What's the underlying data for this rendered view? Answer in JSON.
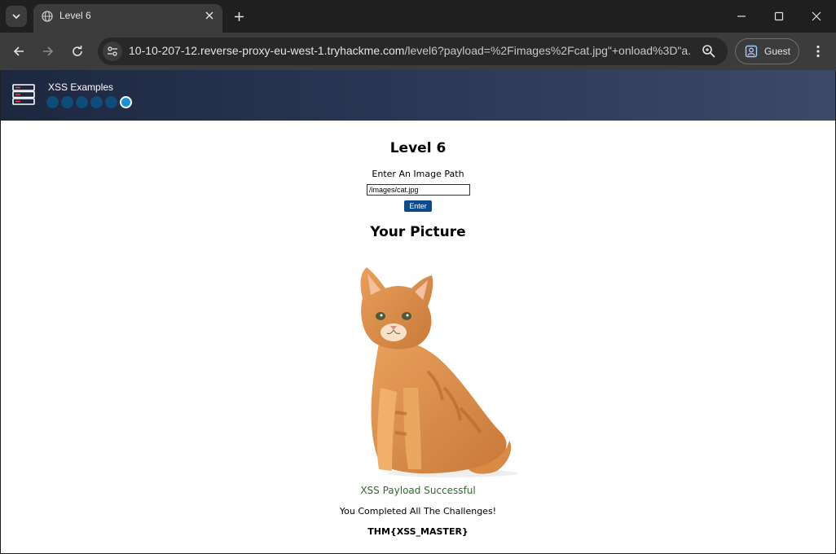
{
  "browser": {
    "tab_title": "Level 6",
    "url_host": "10-10-207-12.reverse-proxy-eu-west-1.tryhackme.com",
    "url_rest": "/level6?payload=%2Fimages%2Fcat.jpg\"+onload%3D\"a...",
    "profile_label": "Guest"
  },
  "header": {
    "title": "XSS Examples",
    "progress_total": 6,
    "progress_current": 6
  },
  "page": {
    "level_title": "Level 6",
    "input_label": "Enter An Image Path",
    "input_value": "/images/cat.jpg",
    "enter_label": "Enter",
    "picture_title": "Your Picture",
    "success_text": "XSS Payload Successful",
    "completed_text": "You Completed All The Challenges!",
    "flag_text": "THM{XSS_MASTER}"
  },
  "colors": {
    "header_bg": "#2c3a58",
    "dot_inactive": "#0e4d7a",
    "dot_active": "#1a8fd8",
    "button_bg": "#0d4a8c",
    "success_text": "#2e6b2e"
  },
  "icons": [
    "tab-search-icon",
    "globe-icon",
    "close-icon",
    "plus-icon",
    "minimize-icon",
    "maximize-icon",
    "window-close-icon",
    "back-arrow-icon",
    "forward-arrow-icon",
    "reload-icon",
    "site-settings-icon",
    "zoom-icon",
    "guest-profile-icon",
    "more-menu-icon",
    "server-icon"
  ]
}
